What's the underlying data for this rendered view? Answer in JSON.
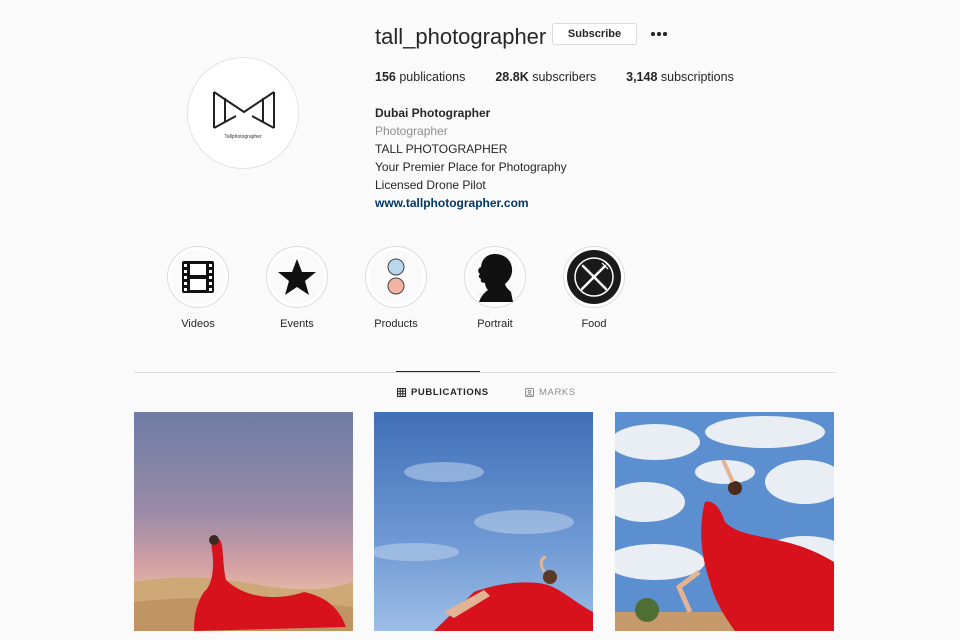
{
  "profile": {
    "username": "tall_photographer",
    "subscribe_label": "Subscribe",
    "more_icon": "more-horizontal-icon",
    "avatar_text": "Tallphotographer"
  },
  "stats": {
    "publications_count": "156",
    "publications_label": "publications",
    "subscribers_count": "28.8K",
    "subscribers_label": "subscribers",
    "subscriptions_count": "3,148",
    "subscriptions_label": "subscriptions"
  },
  "bio": {
    "name": "Dubai Photographer",
    "category": "Photographer",
    "line1": "TALL PHOTOGRAPHER",
    "line2": "Your Premier Place for Photography",
    "line3": "Licensed Drone Pilot",
    "website": "www.tallphotographer.com"
  },
  "highlights": [
    {
      "label": "Videos",
      "icon": "film-icon"
    },
    {
      "label": "Events",
      "icon": "star-icon"
    },
    {
      "label": "Products",
      "icon": "circles-icon"
    },
    {
      "label": "Portrait",
      "icon": "silhouette-icon"
    },
    {
      "label": "Food",
      "icon": "fork-knife-icon"
    }
  ],
  "tabs": [
    {
      "label": "PUBLICATIONS",
      "icon": "grid-icon",
      "active": true
    },
    {
      "label": "MARKS",
      "icon": "tag-icon",
      "active": false
    }
  ],
  "posts": [
    {
      "name": "post-red-dress-dunes-sunset"
    },
    {
      "name": "post-red-dress-reclining-sky"
    },
    {
      "name": "post-red-dress-clouds-pose"
    }
  ],
  "colors": {
    "background": "#fafafa",
    "text": "#262626",
    "muted": "#8e8e8e",
    "link": "#00376b",
    "border": "#dbdbdb",
    "dress_red": "#d8121c"
  }
}
